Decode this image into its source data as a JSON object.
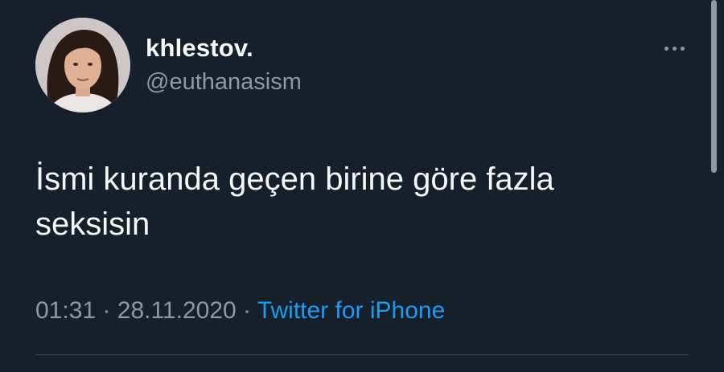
{
  "tweet": {
    "display_name": "khlestov.",
    "handle": "@euthanasism",
    "text": "İsmi kuranda geçen birine göre fazla\nseksisin",
    "time": "01:31",
    "separator": "·",
    "date": "28.11.2020",
    "source": "Twitter for iPhone",
    "avatar_icon": "user-avatar-photo",
    "more_icon": "more-dots-icon"
  },
  "colors": {
    "background": "#15202b",
    "primary_text": "#f7f9f9",
    "secondary_text": "#8b98a5",
    "link": "#1d9bf0",
    "divider": "#38444d"
  }
}
